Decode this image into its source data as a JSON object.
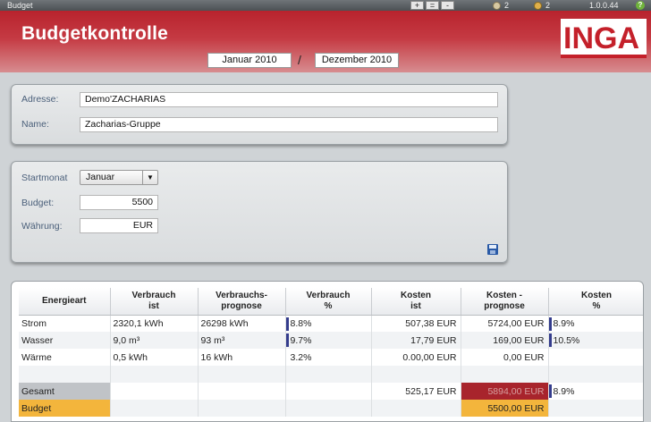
{
  "topbar": {
    "title": "Budget",
    "btn_plus": "+",
    "btn_eq": "=",
    "btn_minus": "-",
    "users_count": "2",
    "locks_count": "2",
    "version": "1.0.0.44",
    "help": "?"
  },
  "header": {
    "title": "Budgetkontrolle",
    "date_from": "Januar 2010",
    "date_sep": "/",
    "date_to": "Dezember 2010",
    "logo_text": "INGA"
  },
  "address_panel": {
    "adresse_label": "Adresse:",
    "adresse_value": "Demo'ZACHARIAS",
    "name_label": "Name:",
    "name_value": "Zacharias-Gruppe"
  },
  "budget_panel": {
    "startmonat_label": "Startmonat",
    "startmonat_value": "Januar",
    "budget_label": "Budget:",
    "budget_value": "5500",
    "waehrung_label": "Währung:",
    "waehrung_value": "EUR"
  },
  "table": {
    "headers": [
      {
        "l1": "Energieart",
        "l2": ""
      },
      {
        "l1": "Verbrauch",
        "l2": "ist"
      },
      {
        "l1": "Verbrauchs-",
        "l2": "prognose"
      },
      {
        "l1": "Verbrauch",
        "l2": "%"
      },
      {
        "l1": "Kosten",
        "l2": "ist"
      },
      {
        "l1": "Kosten -",
        "l2": "prognose"
      },
      {
        "l1": "Kosten",
        "l2": "%"
      }
    ],
    "rows": [
      {
        "energieart": "Strom",
        "verbrauch_ist": "2320,1 kWh",
        "verbrauch_prognose": "26298 kWh",
        "verbrauch_pct": "8.8%",
        "kosten_ist": "507,38 EUR",
        "kosten_prognose": "5724,00 EUR",
        "kosten_pct": "8.9%"
      },
      {
        "energieart": "Wasser",
        "verbrauch_ist": "9,0 m³",
        "verbrauch_prognose": "93 m³",
        "verbrauch_pct": "9.7%",
        "kosten_ist": "17,79 EUR",
        "kosten_prognose": "169,00 EUR",
        "kosten_pct": "10.5%"
      },
      {
        "energieart": "Wärme",
        "verbrauch_ist": "0,5 kWh",
        "verbrauch_prognose": "16 kWh",
        "verbrauch_pct": "3.2%",
        "kosten_ist": "0.00,00 EUR",
        "kosten_prognose": "0,00 EUR",
        "kosten_pct": ""
      }
    ],
    "gesamt": {
      "label": "Gesamt",
      "kosten_ist": "525,17 EUR",
      "kosten_prognose": "5894,00 EUR",
      "kosten_pct": "8.9%"
    },
    "budget": {
      "label": "Budget",
      "kosten_prognose": "5500,00 EUR"
    }
  },
  "colors": {
    "header_red": "#b8232d",
    "label_blue": "#4a5f7a",
    "total_red": "#a8242c",
    "budget_orange": "#f3b53c",
    "bar_navy": "#343c8c"
  }
}
